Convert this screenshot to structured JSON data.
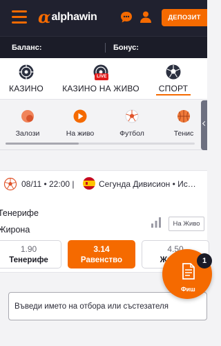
{
  "header": {
    "logo_text": "alphawin",
    "deposit_label": "ДЕПОЗИТ"
  },
  "account": {
    "balance_label": "Баланс:",
    "bonus_label": "Бонус:"
  },
  "main_nav": {
    "items": [
      {
        "label": "КАЗИНО",
        "icon": "roulette-icon"
      },
      {
        "label": "КАЗИНО НА ЖИВО",
        "icon": "live-roulette-icon",
        "badge": "LIVE"
      },
      {
        "label": "СПОРТ",
        "icon": "sport-ball-icon",
        "active": true
      }
    ]
  },
  "sub_nav": {
    "items": [
      {
        "label": "Залози",
        "icon": "bets-icon"
      },
      {
        "label": "На живо",
        "icon": "play-icon"
      },
      {
        "label": "Футбол",
        "icon": "football-icon"
      },
      {
        "label": "Тенис",
        "icon": "basketball-icon"
      }
    ]
  },
  "match": {
    "date_time": "08/11 • 22:00 |",
    "league": "Сегунда Дивисион • Ис…",
    "team_home": "Тенерифе",
    "team_away": "Жирона",
    "live_button": "На Живо",
    "odds": [
      {
        "value": "1.90",
        "label": "Тенерифе"
      },
      {
        "value": "3.14",
        "label": "Равенство",
        "selected": true
      },
      {
        "value": "4.50",
        "label": "Жирона"
      }
    ]
  },
  "search": {
    "placeholder": "Въведи името на отбора или състезателя"
  },
  "betslip": {
    "label": "Фиш",
    "count": "1"
  },
  "colors": {
    "accent": "#f56a00",
    "header_bg": "#20212f",
    "live_badge": "#e01b1b"
  }
}
